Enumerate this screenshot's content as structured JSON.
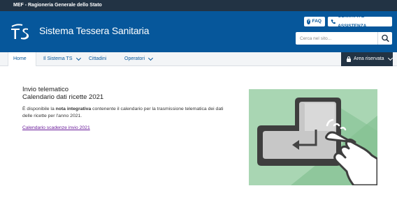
{
  "topbar": {
    "text": "MEF - Ragioneria Generale dello Stato"
  },
  "header": {
    "logo_text": "TS",
    "site_title": "Sistema Tessera Sanitaria",
    "faq_label": "FAQ",
    "contact_label": "CONTATTI E ASSISTENZA",
    "search_placeholder": "Cerca nel sito...",
    "colors": {
      "brand_blue": "#06579b",
      "dark": "#223344"
    }
  },
  "nav": {
    "items": [
      {
        "label": "Home",
        "active": true
      },
      {
        "label": "Il Sistema TS",
        "dropdown": true
      },
      {
        "label": "Cittadini"
      },
      {
        "label": "Operatori",
        "dropdown": true
      }
    ],
    "area_riservata": "Area riservata"
  },
  "main": {
    "title_line1": "Invio telematico",
    "title_line2": "Calendario dati ricette 2021",
    "para_before": "È disponibile la ",
    "para_bold": "nota integrativa",
    "para_after": " contenente il calendario per la trasmissione telematica dei dati delle ricette per l'anno 2021.",
    "link_text": "Calendario scadenze invio 2021"
  },
  "icons": [
    "phone-icon",
    "question-icon",
    "search-icon",
    "lock-icon",
    "chevron-down-icon",
    "enter-key-icon",
    "pointing-hand-icon"
  ]
}
